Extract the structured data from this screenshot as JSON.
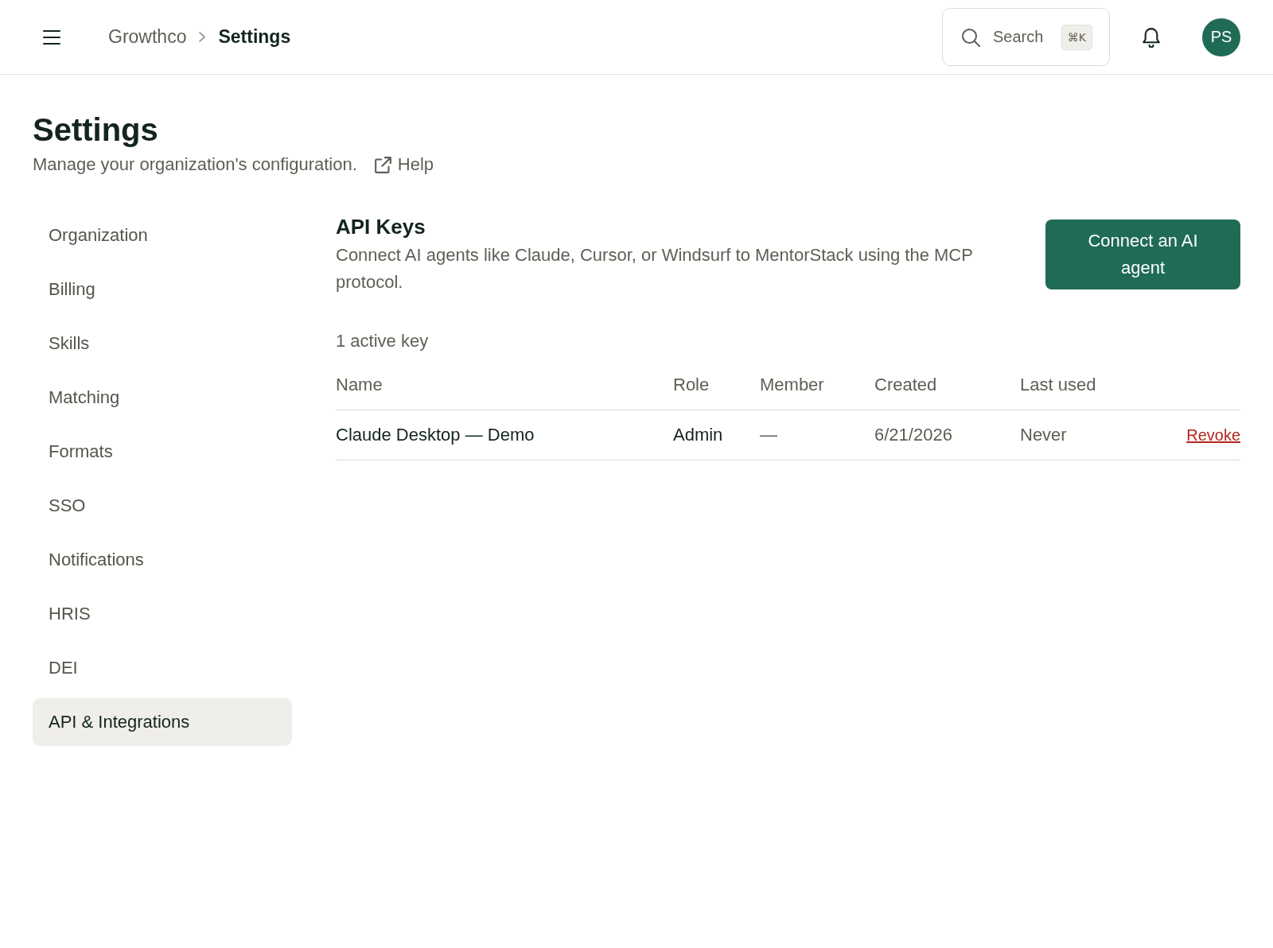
{
  "topbar": {
    "breadcrumb": {
      "parent": "Growthco",
      "current": "Settings"
    },
    "search": {
      "label": "Search",
      "shortcut": "⌘K"
    },
    "avatar": "PS"
  },
  "header": {
    "title": "Settings",
    "subtitle": "Manage your organization's configuration.",
    "help_link": "Help"
  },
  "sidebar": {
    "items": [
      {
        "label": "Organization",
        "selected": false
      },
      {
        "label": "Billing",
        "selected": false
      },
      {
        "label": "Skills",
        "selected": false
      },
      {
        "label": "Matching",
        "selected": false
      },
      {
        "label": "Formats",
        "selected": false
      },
      {
        "label": "SSO",
        "selected": false
      },
      {
        "label": "Notifications",
        "selected": false
      },
      {
        "label": "HRIS",
        "selected": false
      },
      {
        "label": "DEI",
        "selected": false
      },
      {
        "label": "API & Integrations",
        "selected": true
      }
    ]
  },
  "api_keys": {
    "title": "API Keys",
    "description": "Connect AI agents like Claude, Cursor, or Windsurf to MentorStack using the MCP protocol.",
    "connect_button": "Connect an AI agent",
    "count": "1 active key",
    "table": {
      "columns": [
        "Name",
        "Role",
        "Member",
        "Created",
        "Last used"
      ],
      "rows": [
        {
          "cells": [
            "Claude Desktop — Demo",
            "Admin",
            "—",
            "6/21/2026",
            "Never"
          ],
          "action": "Revoke"
        }
      ]
    }
  }
}
